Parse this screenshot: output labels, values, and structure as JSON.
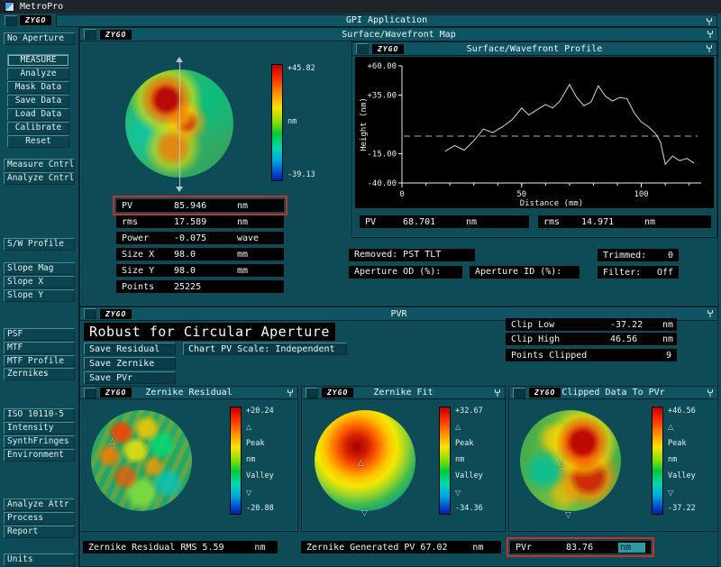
{
  "window": {
    "title": "MetroPro"
  },
  "app": {
    "title": "GPI Application",
    "logo": "ZYGO"
  },
  "colors": {
    "highlight_red": "#c8312b",
    "panel_bg": "#0d4b57",
    "box_bg": "#000000"
  },
  "icons": {
    "triangle_up": "△",
    "triangle_down": "▽"
  },
  "sidebar": {
    "aperture": "No Aperture",
    "g1": [
      "MEASURE",
      "Analyze",
      "Mask Data",
      "Save Data",
      "Load Data",
      "Calibrate",
      "Reset"
    ],
    "g2": [
      "Measure Cntrl",
      "Analyze Cntrl"
    ],
    "g3": [
      "S/W Profile"
    ],
    "g4": [
      "Slope Mag",
      "Slope X",
      "Slope Y"
    ],
    "g5": [
      "PSF",
      "MTF",
      "MTF Profile",
      "Zernikes"
    ],
    "g6": [
      "ISO 10110-5",
      "Intensity",
      "SynthFringes",
      "Environment"
    ],
    "g7": [
      "Analyze Attr",
      "Process",
      "Report"
    ],
    "g8": [
      "Units"
    ]
  },
  "map_panel": {
    "title": "Surface/Wavefront Map",
    "scale_max": "+45.82",
    "scale_unit": "nm",
    "scale_min": "-39.13",
    "stats": {
      "pv": {
        "label": "PV",
        "value": "85.946",
        "unit": "nm"
      },
      "rms": {
        "label": "rms",
        "value": "17.589",
        "unit": "nm"
      },
      "power": {
        "label": "Power",
        "value": "-0.075",
        "unit": "wave"
      },
      "size_x": {
        "label": "Size X",
        "value": "98.0",
        "unit": "mm"
      },
      "size_y": {
        "label": "Size Y",
        "value": "98.0",
        "unit": "mm"
      },
      "points": {
        "label": "Points",
        "value": "25225",
        "unit": ""
      }
    }
  },
  "profile_panel": {
    "title": "Surface/Wavefront Profile",
    "pv": {
      "label": "PV",
      "value": "68.701",
      "unit": "nm"
    },
    "rms": {
      "label": "rms",
      "value": "14.971",
      "unit": "nm"
    }
  },
  "removed_row": {
    "removed": "Removed: PST TLT",
    "trimmed_label": "Trimmed:",
    "trimmed_value": "0",
    "aperture_od": "Aperture OD (%):",
    "aperture_id": "Aperture ID (%):",
    "filter_label": "Filter:",
    "filter_value": "Off"
  },
  "pvr": {
    "title": "PVR",
    "header": "Robust for Circular Aperture",
    "buttons": {
      "save_residual": "Save Residual",
      "chart_scale": "Chart PV Scale: Independent",
      "save_zernike": "Save Zernike",
      "save_pvr": "Save PVr"
    },
    "clip_low": {
      "label": "Clip Low",
      "value": "-37.22",
      "unit": "nm"
    },
    "clip_high": {
      "label": "Clip High",
      "value": "46.56",
      "unit": "nm"
    },
    "points_clipped": {
      "label": "Points Clipped",
      "value": "9"
    }
  },
  "zernike_residual": {
    "title": "Zernike Residual",
    "scale_max": "+20.24",
    "peak": "Peak",
    "unit": "nm",
    "valley": "Valley",
    "scale_min": "-20.88"
  },
  "zernike_fit": {
    "title": "Zernike Fit",
    "scale_max": "+32.67",
    "peak": "Peak",
    "unit": "nm",
    "valley": "Valley",
    "scale_min": "-34.36"
  },
  "clipped_panel": {
    "title": "Clipped Data To PVr",
    "scale_max": "+46.56",
    "peak": "Peak",
    "unit": "nm",
    "valley": "Valley",
    "scale_min": "-37.22"
  },
  "bottom": {
    "residual_rms": {
      "label": "Zernike Residual RMS",
      "value": "5.59",
      "unit": "nm"
    },
    "generated_pv": {
      "label": "Zernike Generated PV",
      "value": "67.02",
      "unit": "nm"
    },
    "pvr": {
      "label": "PVr",
      "value": "83.76",
      "unit": "nm"
    }
  },
  "chart_data": {
    "type": "line",
    "title": "Surface/Wavefront Profile",
    "xlabel": "Distance (mm)",
    "ylabel": "Height (nm)",
    "xlim": [
      0,
      125
    ],
    "ylim": [
      -40,
      60
    ],
    "ref_line": 0,
    "legend": "none",
    "y_ticks": [
      {
        "v": 60,
        "label": "+60.00"
      },
      {
        "v": 35,
        "label": "+35.00"
      },
      {
        "v": -15,
        "label": "-15.00"
      },
      {
        "v": -40,
        "label": "-40.00"
      }
    ],
    "x_ticks": [
      {
        "v": 0,
        "label": "0"
      },
      {
        "v": 50,
        "label": "50"
      },
      {
        "v": 100,
        "label": "100"
      }
    ],
    "x": [
      18,
      22,
      26,
      30,
      34,
      38,
      42,
      46,
      50,
      53,
      56,
      60,
      63,
      66,
      70,
      73,
      76,
      79,
      82,
      85,
      88,
      91,
      94,
      97,
      100,
      103,
      106,
      108,
      110,
      113,
      116,
      119,
      122
    ],
    "y": [
      -13,
      -8,
      -12,
      -4,
      6,
      3,
      8,
      14,
      24,
      18,
      22,
      27,
      24,
      30,
      44,
      33,
      26,
      29,
      43,
      34,
      30,
      33,
      32,
      20,
      12,
      8,
      2,
      -5,
      -24,
      -17,
      -21,
      -19,
      -23
    ]
  }
}
